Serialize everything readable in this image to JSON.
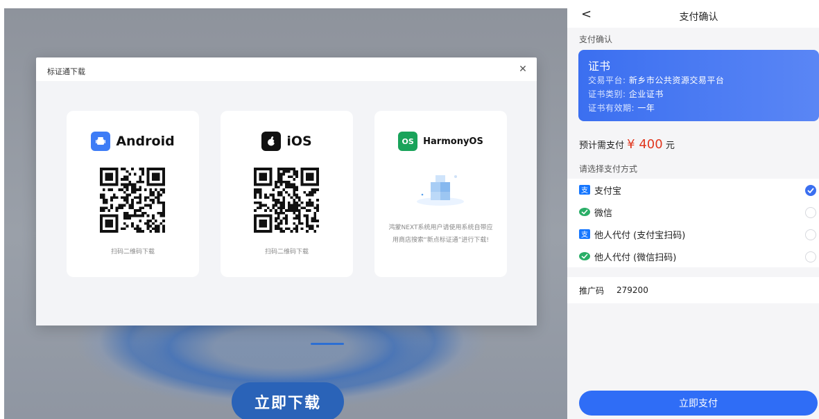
{
  "left": {
    "modal": {
      "title": "标证通下载",
      "cards": [
        {
          "name": "Android",
          "caption": "扫码二维码下载"
        },
        {
          "name": "iOS",
          "caption": "扫码二维码下载"
        },
        {
          "name": "HarmonyOS",
          "caption_line1": "鸿蒙NEXT系统用户请使用系统自带应",
          "caption_line2": "用商店搜索“新点标证通”进行下载!"
        }
      ]
    },
    "download_button": "立即下载",
    "colors": {
      "android": "#3d7cf6",
      "ios": "#111111",
      "harmony": "#19a35a"
    }
  },
  "right": {
    "page_title": "支付确认",
    "subtitle": "支付确认",
    "cert": {
      "title": "证书",
      "rows": [
        {
          "key": "交易平台:",
          "value": "新乡市公共资源交易平台"
        },
        {
          "key": "证书类别:",
          "value": "企业证书"
        },
        {
          "key": "证书有效期:",
          "value": "一年"
        }
      ]
    },
    "amount": {
      "prefix": "预计需支付",
      "price": "¥ 400",
      "unit": "元"
    },
    "choose_label": "请选择支付方式",
    "methods": [
      {
        "label": "支付宝",
        "icon": "alipay-icon",
        "selected": true
      },
      {
        "label": "微信",
        "icon": "wechat-icon",
        "selected": false
      },
      {
        "label": "他人代付 (支付宝扫码)",
        "icon": "alipay-icon",
        "selected": false
      },
      {
        "label": "他人代付 (微信扫码)",
        "icon": "wechat-icon",
        "selected": false
      }
    ],
    "promo": {
      "key": "推广码",
      "value": "279200"
    },
    "pay_button": "立即支付",
    "colors": {
      "accent": "#2f6df6",
      "price": "#e1371f",
      "alipay": "#1677ff",
      "wechat": "#2aae67"
    }
  }
}
